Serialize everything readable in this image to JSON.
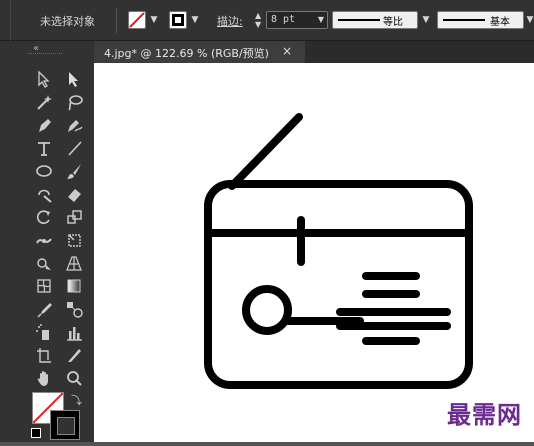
{
  "control_panel": {
    "selection_label": "未选择对象",
    "stroke_label": "描边:",
    "stroke_weight": "8 pt",
    "profile_1_label": "等比",
    "profile_2_label": "基本"
  },
  "document_tab": {
    "title": "4.jpg* @ 122.69 % (RGB/预览)",
    "close_glyph": "×"
  },
  "toolbar": {
    "collapse_glyph": "«",
    "tools": [
      "selection-tool",
      "direct-selection-tool",
      "magic-wand-tool",
      "lasso-tool",
      "pen-tool",
      "curvature-tool",
      "type-tool",
      "line-tool",
      "ellipse-tool",
      "paintbrush-tool",
      "shaper-tool",
      "eraser-tool",
      "rotate-tool",
      "scale-tool",
      "width-tool",
      "free-transform-tool",
      "shape-builder-tool",
      "perspective-grid-tool",
      "mesh-tool",
      "gradient-tool",
      "eyedropper-tool",
      "blend-tool",
      "symbol-sprayer-tool",
      "column-graph-tool",
      "artboard-tool",
      "slice-tool",
      "hand-tool",
      "zoom-tool"
    ]
  },
  "watermark": "最需网",
  "colors": {
    "panel": "#323232",
    "workspace": "#535353",
    "canvas": "#ffffff",
    "artwork": "#000000",
    "watermark": "#6b2a8f"
  }
}
